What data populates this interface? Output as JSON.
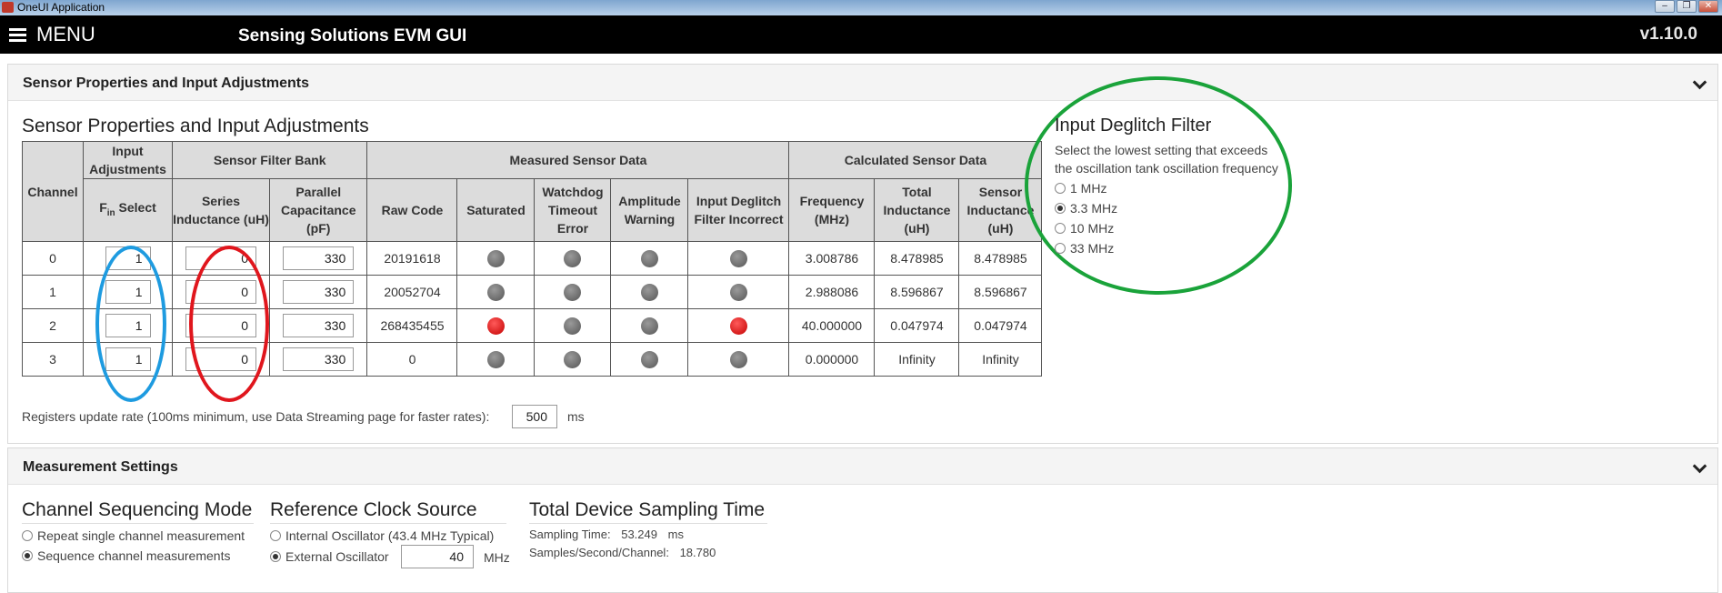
{
  "window": {
    "title": "OneUI Application",
    "controls": [
      "minimize-icon",
      "restore-icon",
      "close-icon"
    ]
  },
  "appbar": {
    "menu_label": "MENU",
    "app_name": "Sensing Solutions EVM GUI",
    "version": "v1.10.0"
  },
  "panel1": {
    "header": "Sensor Properties and Input Adjustments",
    "section_title": "Sensor Properties and Input Adjustments",
    "table": {
      "group_headers": {
        "channel": "Channel",
        "input_adjustments": "Input Adjustments",
        "sensor_filter_bank": "Sensor Filter Bank",
        "measured": "Measured Sensor Data",
        "calculated": "Calculated Sensor Data"
      },
      "columns": {
        "fin_select_main": "F",
        "fin_select_sub": "in",
        "fin_select_rest": " Select",
        "series_inductance": "Series Inductance (uH)",
        "parallel_capacitance": "Parallel Capacitance (pF)",
        "raw_code": "Raw Code",
        "saturated": "Saturated",
        "watchdog": "Watchdog Timeout Error",
        "amplitude": "Amplitude Warning",
        "deglitch_incorrect": "Input Deglitch Filter Incorrect",
        "frequency": "Frequency (MHz)",
        "total_inductance": "Total Inductance (uH)",
        "sensor_inductance": "Sensor Inductance (uH)"
      },
      "rows": [
        {
          "channel": "0",
          "fin": "1",
          "series": "0",
          "parallel": "330",
          "raw": "20191618",
          "saturated": false,
          "watchdog": false,
          "amplitude": false,
          "deglitch": false,
          "frequency": "3.008786",
          "total": "8.478985",
          "sensor": "8.478985"
        },
        {
          "channel": "1",
          "fin": "1",
          "series": "0",
          "parallel": "330",
          "raw": "20052704",
          "saturated": false,
          "watchdog": false,
          "amplitude": false,
          "deglitch": false,
          "frequency": "2.988086",
          "total": "8.596867",
          "sensor": "8.596867"
        },
        {
          "channel": "2",
          "fin": "1",
          "series": "0",
          "parallel": "330",
          "raw": "268435455",
          "saturated": true,
          "watchdog": false,
          "amplitude": false,
          "deglitch": true,
          "frequency": "40.000000",
          "total": "0.047974",
          "sensor": "0.047974"
        },
        {
          "channel": "3",
          "fin": "1",
          "series": "0",
          "parallel": "330",
          "raw": "0",
          "saturated": false,
          "watchdog": false,
          "amplitude": false,
          "deglitch": false,
          "frequency": "0.000000",
          "total": "Infinity",
          "sensor": "Infinity"
        }
      ]
    },
    "update_rate": {
      "label": "Registers update rate (100ms minimum, use Data Streaming page for faster rates):",
      "value": "500",
      "unit": "ms"
    },
    "deglitch": {
      "title": "Input Deglitch Filter",
      "desc_line1": "Select the lowest setting that exceeds",
      "desc_line2": "the oscillation tank oscillation frequency",
      "options": [
        {
          "label": "1 MHz",
          "checked": false
        },
        {
          "label": "3.3 MHz",
          "checked": true
        },
        {
          "label": "10 MHz",
          "checked": false
        },
        {
          "label": "33 MHz",
          "checked": false
        }
      ]
    }
  },
  "panel2": {
    "header": "Measurement Settings",
    "sequencing": {
      "title": "Channel Sequencing Mode",
      "options": [
        {
          "label": "Repeat single channel measurement",
          "checked": false
        },
        {
          "label": "Sequence channel measurements",
          "checked": true
        }
      ]
    },
    "clock": {
      "title": "Reference Clock Source",
      "internal": "Internal Oscillator (43.4 MHz Typical)",
      "internal_checked": false,
      "external": "External Oscillator",
      "external_checked": true,
      "external_value": "40",
      "external_unit": "MHz"
    },
    "sampling": {
      "title": "Total Device Sampling Time",
      "time_label": "Sampling Time:",
      "time_value": "53.249",
      "time_unit": "ms",
      "sps_label": "Samples/Second/Channel:",
      "sps_value": "18.780"
    }
  },
  "annotations": {
    "blue": "#1e9be0",
    "red": "#e0161d",
    "green": "#1aa33a"
  }
}
